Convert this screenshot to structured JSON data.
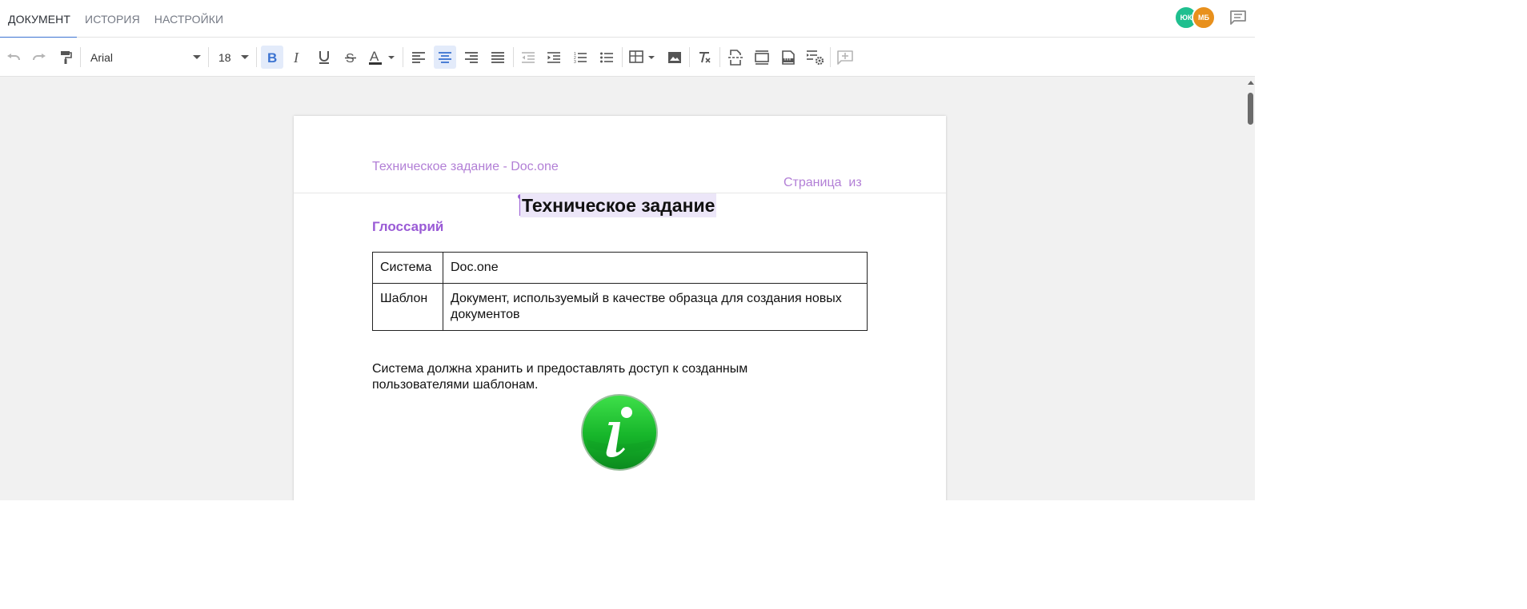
{
  "tabs": [
    {
      "label": "ДОКУМЕНТ",
      "active": true
    },
    {
      "label": "ИСТОРИЯ",
      "active": false
    },
    {
      "label": "НАСТРОЙКИ",
      "active": false
    }
  ],
  "avatars": [
    {
      "initials": "ЮК",
      "color": "#1fbf8f"
    },
    {
      "initials": "МБ",
      "color": "#e8901c"
    }
  ],
  "toolbar": {
    "font_family": "Arial",
    "font_size": "18",
    "bold_active": true,
    "align_center_active": true
  },
  "colors": {
    "accent": "#3b73d1",
    "header_text": "#b27fd6",
    "heading": "#9a5bd6",
    "selection": "#ece6f8"
  },
  "document": {
    "header_title": "Техническое задание - Doc.one",
    "header_page": "Страница  из",
    "title": "Техническое задание",
    "glossary_heading": "Глоссарий",
    "glossary": [
      {
        "term": "Система",
        "definition": "Doc.one"
      },
      {
        "term": "Шаблон",
        "definition": "Документ, используемый в качестве образца для создания новых документов"
      }
    ],
    "paragraph": "Система должна хранить и предоставлять доступ к созданным пользователями шаблонам.",
    "image_icon": "info-icon"
  }
}
